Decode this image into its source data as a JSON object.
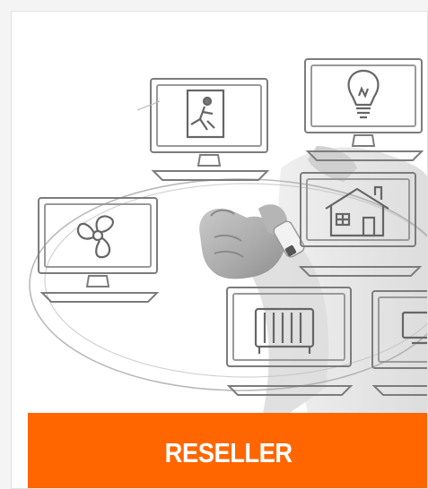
{
  "banner": {
    "cta_label": "RESELLER",
    "accent_color": "#ff6600",
    "illustration_icons": [
      "exit-sign-icon",
      "light-bulb-icon",
      "fan-icon",
      "house-icon",
      "radiator-icon",
      "monitor-icon"
    ]
  }
}
